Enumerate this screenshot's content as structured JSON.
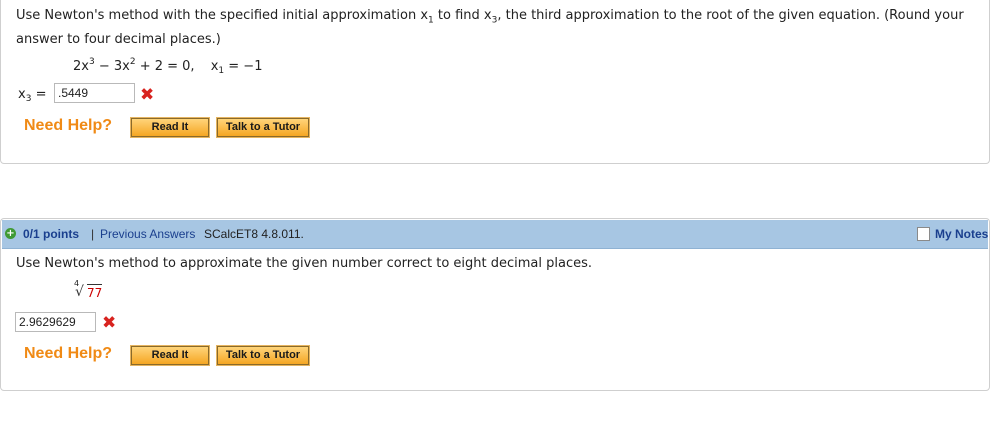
{
  "q1": {
    "prompt_line1": "Use Newton's method with the specified initial approximation x",
    "sub1": "1",
    "prompt_mid": " to find x",
    "sub3": "3",
    "prompt_line1_end": ", the third approximation to the root of the given equation. (Round your",
    "prompt_line2": "answer to four decimal places.)",
    "eq_a": "2x",
    "eq_pow3": "3",
    "eq_b": " − 3x",
    "eq_pow2": "2",
    "eq_c": " + 2 = 0,",
    "eq_x": "x",
    "eq_xsub": "1",
    "eq_val": " = −1",
    "ans_label": "x",
    "ans_sub": "3",
    "ans_eq": " =",
    "answer_value": ".5449",
    "need_help": "Need Help?",
    "read_it": "Read It",
    "talk_tutor": "Talk to a Tutor"
  },
  "q2": {
    "points": "0/1 points",
    "separator": "|",
    "previous_answers": "Previous Answers",
    "ref": "SCalcET8 4.8.011.",
    "my_notes": "My Notes",
    "prompt": "Use Newton's method to approximate the given number correct to eight decimal places.",
    "root_index": "4",
    "radicand": "77",
    "answer_value": "2.9629629",
    "need_help": "Need Help?",
    "read_it": "Read It",
    "talk_tutor": "Talk to a Tutor"
  },
  "colors": {
    "header_bg": "#a7c6e3",
    "need_help": "#f08a15",
    "wrong_mark": "#d8231f",
    "link": "#1a3f8e",
    "radicand": "#cc0000"
  }
}
